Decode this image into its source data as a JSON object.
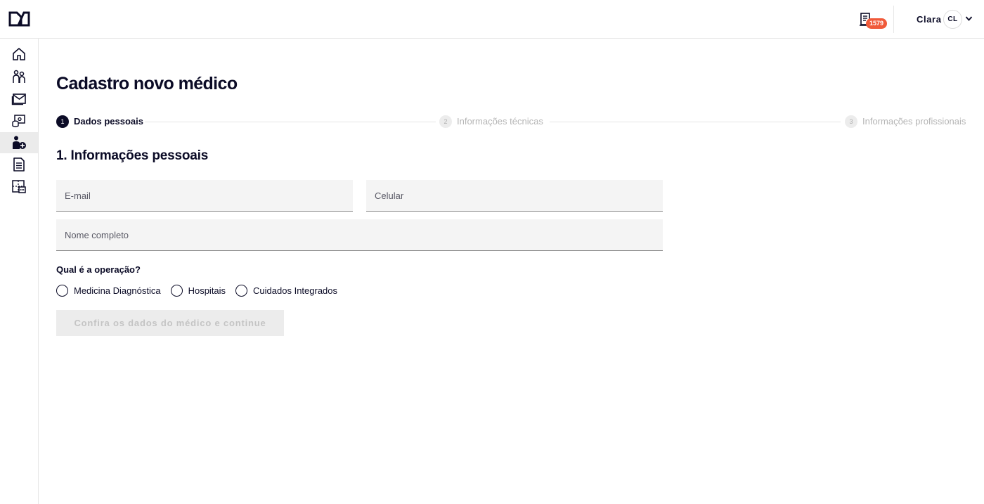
{
  "header": {
    "logo_icon": "da-logo-icon",
    "notifications": {
      "icon": "document-list-icon",
      "count": "1579",
      "badge_color": "#f05a3a"
    },
    "user": {
      "name": "Clara",
      "initials": "CL",
      "menu_icon": "chevron-down-icon"
    }
  },
  "sidebar": {
    "items": [
      {
        "icon": "home-icon",
        "active": false
      },
      {
        "icon": "people-icon",
        "active": false
      },
      {
        "icon": "mail-icon",
        "active": false
      },
      {
        "icon": "billing-icon",
        "active": false
      },
      {
        "icon": "add-user-icon",
        "active": true
      },
      {
        "icon": "document-icon",
        "active": false
      },
      {
        "icon": "grid-chat-icon",
        "active": false
      }
    ]
  },
  "page": {
    "title": "Cadastro novo médico"
  },
  "stepper": {
    "steps": [
      {
        "number": "1",
        "label": "Dados pessoais",
        "active": true
      },
      {
        "number": "2",
        "label": "Informações técnicas",
        "active": false
      },
      {
        "number": "3",
        "label": "Informações profissionais",
        "active": false
      }
    ]
  },
  "form": {
    "section_title": "1. Informações pessoais",
    "email": {
      "placeholder": "E-mail",
      "value": ""
    },
    "phone": {
      "placeholder": "Celular",
      "value": ""
    },
    "full_name": {
      "placeholder": "Nome completo",
      "value": ""
    },
    "operation": {
      "question": "Qual é a operação?",
      "options": [
        "Medicina Diagnóstica",
        "Hospitais",
        "Cuidados Integrados"
      ]
    },
    "submit_label": "Confira os dados do médico e continue"
  },
  "colors": {
    "primary": "#0b0b26",
    "field_bg": "#f4f4f4",
    "disabled_button_bg": "#ececec"
  }
}
